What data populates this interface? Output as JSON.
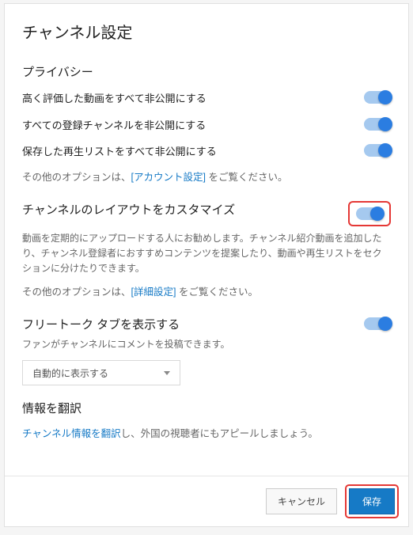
{
  "title": "チャンネル設定",
  "privacy": {
    "heading": "プライバシー",
    "rows": [
      {
        "label": "高く評価した動画をすべて非公開にする",
        "on": true
      },
      {
        "label": "すべての登録チャンネルを非公開にする",
        "on": true
      },
      {
        "label": "保存した再生リストをすべて非公開にする",
        "on": true
      }
    ],
    "hint_prefix": "その他のオプションは、",
    "hint_link": "[アカウント設定]",
    "hint_suffix": " をご覧ください。"
  },
  "layout": {
    "heading": "チャンネルのレイアウトをカスタマイズ",
    "on": true,
    "desc": "動画を定期的にアップロードする人にお勧めします。チャンネル紹介動画を追加したり、チャンネル登録者におすすめコンテンツを提案したり、動画や再生リストをセクションに分けたりできます。",
    "hint_prefix": "その他のオプションは、",
    "hint_link": "[詳細設定]",
    "hint_suffix": " をご覧ください。"
  },
  "freetalk": {
    "heading": "フリートーク タブを表示する",
    "on": true,
    "desc": "ファンがチャンネルにコメントを投稿できます。",
    "select_value": "自動的に表示する"
  },
  "translate": {
    "heading": "情報を翻訳",
    "link": "チャンネル情報を翻訳",
    "suffix": "し、外国の視聴者にもアピールしましょう。"
  },
  "footer": {
    "cancel": "キャンセル",
    "save": "保存"
  }
}
